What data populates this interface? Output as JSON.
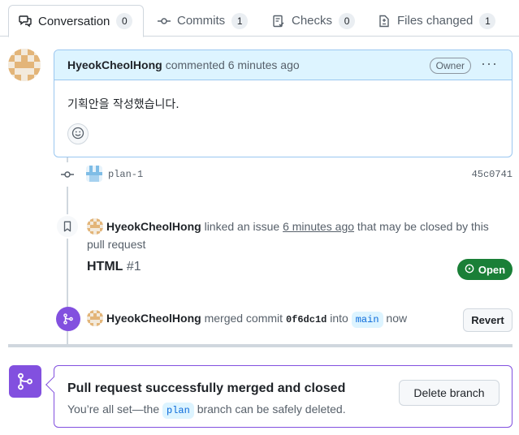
{
  "tabs": [
    {
      "label": "Conversation",
      "count": "0",
      "icon": "comment-discussion-icon"
    },
    {
      "label": "Commits",
      "count": "1",
      "icon": "git-commit-icon"
    },
    {
      "label": "Checks",
      "count": "0",
      "icon": "checklist-icon"
    },
    {
      "label": "Files changed",
      "count": "1",
      "icon": "file-diff-icon"
    }
  ],
  "comment": {
    "author": "HyeokCheolHong",
    "meta": "commented 6 minutes ago",
    "badge": "Owner",
    "menu": "···",
    "body": "기획안을 작성했습니다."
  },
  "commit": {
    "message": "plan-1",
    "sha": "45c0741"
  },
  "linked": {
    "author": "HyeokCheolHong",
    "text1": " linked an issue ",
    "time": "6 minutes ago",
    "text2": " that may be closed by this pull request",
    "issue_title": "HTML",
    "issue_number": "#1",
    "issue_state": "Open"
  },
  "merged": {
    "author": "HyeokCheolHong",
    "text1": " merged commit ",
    "sha": "0f6dc1d",
    "text2": " into ",
    "branch": "main",
    "text3": " now",
    "revert_label": "Revert"
  },
  "merge_box": {
    "title": "Pull request successfully merged and closed",
    "sub_prefix": "You’re all set—the ",
    "branch": "plan",
    "sub_suffix": " branch can be safely deleted.",
    "delete_label": "Delete branch"
  },
  "colors": {
    "merged_purple": "#8250df",
    "open_green": "#1a7f37",
    "link_blue": "#0969da",
    "header_blue": "#ddf4ff"
  }
}
